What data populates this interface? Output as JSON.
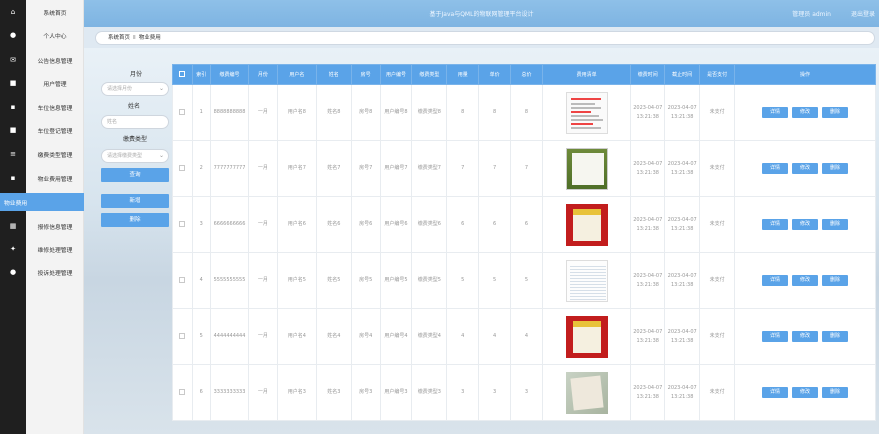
{
  "header": {
    "title": "基于Java与QML的物联网管理平台设计",
    "user_label": "管理员 admin",
    "logout_label": "退出登录"
  },
  "sidebar": {
    "items": [
      {
        "label": "系统首页",
        "icon": "home-icon"
      },
      {
        "label": "个人中心",
        "icon": "person-icon"
      },
      {
        "label": "公告信息管理",
        "icon": "notice-icon"
      },
      {
        "label": "用户管理",
        "icon": "users-icon"
      },
      {
        "label": "车位信息管理",
        "icon": "grid-icon"
      },
      {
        "label": "车位登记管理",
        "icon": "register-icon"
      },
      {
        "label": "缴费类型管理",
        "icon": "list-icon"
      },
      {
        "label": "物业费用管理",
        "icon": "grid-icon"
      },
      {
        "label": "物业费用",
        "icon": "",
        "active": true
      },
      {
        "label": "报修信息管理",
        "icon": "table-icon"
      },
      {
        "label": "维修处理管理",
        "icon": "repair-icon"
      },
      {
        "label": "投诉处理管理",
        "icon": "complaint-icon"
      }
    ]
  },
  "breadcrumb": {
    "home": "系统首页",
    "separator": "Ⅱ",
    "current": "物业费用"
  },
  "filters": {
    "month_label": "月份",
    "month_placeholder": "请选择月份",
    "name_label": "姓名",
    "name_placeholder": "姓名",
    "type_label": "缴费类型",
    "type_placeholder": "请选择缴费类型",
    "query_button": "查询",
    "add_button": "新增",
    "delete_button": "删除"
  },
  "table": {
    "columns": [
      "",
      "索引",
      "缴费编号",
      "月份",
      "用户名",
      "姓名",
      "房号",
      "用户编号",
      "缴费类型",
      "用量",
      "单价",
      "总价",
      "费用清单",
      "缴费时间",
      "截止时间",
      "是否支付",
      "操作"
    ],
    "rows": [
      {
        "index": "1",
        "code": "8888888888",
        "month": "一月",
        "username": "用户名8",
        "name": "姓名8",
        "room": "房号8",
        "userno": "用户编号8",
        "type": "缴费类型8",
        "usage": "8",
        "price": "8",
        "total": "8",
        "thumb": "doc",
        "paytime": "2023-04-07 13:21:38",
        "deadline": "2023-04-07 13:21:38",
        "paid": "未支付"
      },
      {
        "index": "2",
        "code": "7777777777",
        "month": "一月",
        "username": "用户名7",
        "name": "姓名7",
        "room": "房号7",
        "userno": "用户编号7",
        "type": "缴费类型7",
        "usage": "7",
        "price": "7",
        "total": "7",
        "thumb": "green",
        "paytime": "2023-04-07 13:21:38",
        "deadline": "2023-04-07 13:21:38",
        "paid": "未支付"
      },
      {
        "index": "3",
        "code": "6666666666",
        "month": "一月",
        "username": "用户名6",
        "name": "姓名6",
        "room": "房号6",
        "userno": "用户编号6",
        "type": "缴费类型6",
        "usage": "6",
        "price": "6",
        "total": "6",
        "thumb": "red",
        "paytime": "2023-04-07 13:21:38",
        "deadline": "2023-04-07 13:21:38",
        "paid": "未支付"
      },
      {
        "index": "4",
        "code": "5555555555",
        "month": "一月",
        "username": "用户名5",
        "name": "姓名5",
        "room": "房号5",
        "userno": "用户编号5",
        "type": "缴费类型5",
        "usage": "5",
        "price": "5",
        "total": "5",
        "thumb": "sheet",
        "paytime": "2023-04-07 13:21:38",
        "deadline": "2023-04-07 13:21:38",
        "paid": "未支付"
      },
      {
        "index": "5",
        "code": "4444444444",
        "month": "一月",
        "username": "用户名4",
        "name": "姓名4",
        "room": "房号4",
        "userno": "用户编号4",
        "type": "缴费类型4",
        "usage": "4",
        "price": "4",
        "total": "4",
        "thumb": "red",
        "paytime": "2023-04-07 13:21:38",
        "deadline": "2023-04-07 13:21:38",
        "paid": "未支付"
      },
      {
        "index": "6",
        "code": "3333333333",
        "month": "一月",
        "username": "用户名3",
        "name": "姓名3",
        "room": "房号3",
        "userno": "用户编号3",
        "type": "缴费类型3",
        "usage": "3",
        "price": "3",
        "total": "3",
        "thumb": "photo",
        "paytime": "2023-04-07 13:21:38",
        "deadline": "2023-04-07 13:21:38",
        "paid": "未支付"
      }
    ],
    "actions": {
      "detail": "详情",
      "edit": "修改",
      "delete": "删除"
    }
  },
  "colors": {
    "accent": "#5aa3e8",
    "rail": "#1f1f1f",
    "topbar": "#8ec0e8"
  }
}
